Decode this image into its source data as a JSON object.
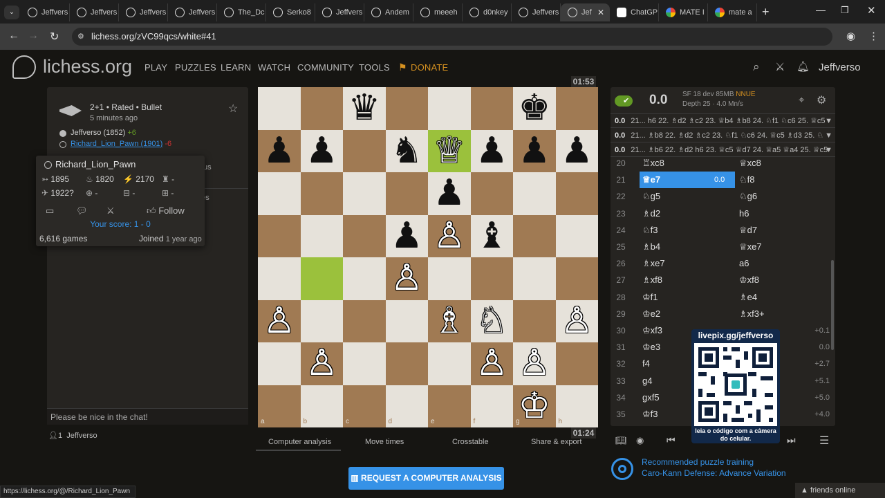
{
  "browser": {
    "tabs": [
      {
        "label": "Jeffvers",
        "icon": "lichess-icon"
      },
      {
        "label": "Jeffvers",
        "icon": "lichess-icon"
      },
      {
        "label": "Jeffvers",
        "icon": "lichess-icon"
      },
      {
        "label": "Jeffvers",
        "icon": "lichess-icon"
      },
      {
        "label": "The_Dc",
        "icon": "lichess-icon"
      },
      {
        "label": "Serko8",
        "icon": "lichess-icon"
      },
      {
        "label": "Jeffvers",
        "icon": "lichess-icon"
      },
      {
        "label": "Andem",
        "icon": "lichess-icon"
      },
      {
        "label": "meeeh",
        "icon": "lichess-icon"
      },
      {
        "label": "d0nkey",
        "icon": "lichess-icon"
      },
      {
        "label": "Jeffvers",
        "icon": "lichess-icon"
      },
      {
        "label": "Jef",
        "icon": "lichess-icon",
        "active": true
      },
      {
        "label": "ChatGP",
        "icon": "chatgpt-icon"
      },
      {
        "label": "MATE I",
        "icon": "google-icon"
      },
      {
        "label": "mate a",
        "icon": "google-icon"
      }
    ],
    "url": "lichess.org/zVC99qcs/white#41",
    "status_url": "https://lichess.org/@/Richard_Lion_Pawn"
  },
  "site": {
    "logo": "lichess.org",
    "nav": [
      "PLAY",
      "PUZZLES",
      "LEARN",
      "WATCH",
      "COMMUNITY",
      "TOOLS"
    ],
    "donate": "DONATE",
    "username": "Jeffverso"
  },
  "game": {
    "mode": "2+1 • Rated • Bullet",
    "time_ago": "5 minutes ago",
    "white_player": "Jeffverso (1852)",
    "white_diff": "+6",
    "black_player": "Richard_Lion_Pawn (1901)",
    "black_diff": "-6",
    "chat_placeholder": "Please be nice in the chat!",
    "spectators": "1",
    "spectator_name": "Jeffverso",
    "hidden_tab_text": "us",
    "hidden_tab_text2": "otes"
  },
  "popup": {
    "name": "Richard_Lion_Pawn",
    "ratings": [
      "1895",
      "1820",
      "2170",
      "-",
      "1922?",
      "-",
      "-",
      "-"
    ],
    "follow": "Follow",
    "score_label": "Your score:",
    "score": "1 - 0",
    "games": "6,616 games",
    "joined_label": "Joined",
    "joined": "1 year ago"
  },
  "board": {
    "clock_top": "01:53",
    "clock_bottom": "01:24",
    "ranks": [
      "8",
      "7",
      "6",
      "5",
      "4",
      "3",
      "2",
      "1"
    ],
    "files": [
      "a",
      "b",
      "c",
      "d",
      "e",
      "f",
      "g",
      "h"
    ],
    "highlight_squares": [
      "e7",
      "b4"
    ],
    "pieces": [
      {
        "sq": "c8",
        "glyph": "♛",
        "color": "b"
      },
      {
        "sq": "g8",
        "glyph": "♚",
        "color": "b"
      },
      {
        "sq": "a7",
        "glyph": "♟",
        "color": "b"
      },
      {
        "sq": "b7",
        "glyph": "♟",
        "color": "b"
      },
      {
        "sq": "d7",
        "glyph": "♞",
        "color": "b"
      },
      {
        "sq": "e7",
        "glyph": "♕",
        "color": "w"
      },
      {
        "sq": "f7",
        "glyph": "♟",
        "color": "b"
      },
      {
        "sq": "g7",
        "glyph": "♟",
        "color": "b"
      },
      {
        "sq": "h7",
        "glyph": "♟",
        "color": "b"
      },
      {
        "sq": "e6",
        "glyph": "♟",
        "color": "b"
      },
      {
        "sq": "d5",
        "glyph": "♟",
        "color": "b"
      },
      {
        "sq": "e5",
        "glyph": "♙",
        "color": "w"
      },
      {
        "sq": "f5",
        "glyph": "♝",
        "color": "b"
      },
      {
        "sq": "d4",
        "glyph": "♙",
        "color": "w"
      },
      {
        "sq": "a3",
        "glyph": "♙",
        "color": "w"
      },
      {
        "sq": "e3",
        "glyph": "♗",
        "color": "w"
      },
      {
        "sq": "f3",
        "glyph": "♘",
        "color": "w"
      },
      {
        "sq": "h3",
        "glyph": "♙",
        "color": "w"
      },
      {
        "sq": "b2",
        "glyph": "♙",
        "color": "w"
      },
      {
        "sq": "f2",
        "glyph": "♙",
        "color": "w"
      },
      {
        "sq": "g2",
        "glyph": "♙",
        "color": "w"
      },
      {
        "sq": "g1",
        "glyph": "♔",
        "color": "w"
      }
    ]
  },
  "under_board_tabs": [
    "Computer analysis",
    "Move times",
    "Crosstable",
    "Share & export"
  ],
  "request_analysis": "REQUEST A COMPUTER ANALYSIS",
  "engine": {
    "eval": "0.0",
    "name": "SF 18 dev 85MB",
    "nnue": "NNUE",
    "depth": "Depth 25 · 4.0 Mn/s",
    "lines": [
      {
        "eval": "0.0",
        "moves": "21... h6 22. ♗d2 ♗c2 23. ♕b4 ♗b8 24. ♘f1 ♘c6 25. ♕c5"
      },
      {
        "eval": "0.0",
        "moves": "21... ♗b8 22. ♗d2 ♗c2 23. ♘f1 ♘c6 24. ♕c5 ♗d3 25. ♘"
      },
      {
        "eval": "0.0",
        "moves": "21... ♗b6 22. ♗d2 h6 23. ♕c5 ♕d7 24. ♕a5 ♕a4 25. ♕c5"
      }
    ]
  },
  "moves": [
    {
      "n": "20",
      "w": "♖xc8",
      "b": "♕xc8",
      "ev": ""
    },
    {
      "n": "21",
      "w": "♕e7",
      "b": "♘f8",
      "ev": "0.0",
      "current": true
    },
    {
      "n": "22",
      "w": "♘g5",
      "b": "♘g6",
      "ev": ""
    },
    {
      "n": "23",
      "w": "♗d2",
      "b": "h6",
      "ev": ""
    },
    {
      "n": "24",
      "w": "♘f3",
      "b": "♕d7",
      "ev": ""
    },
    {
      "n": "25",
      "w": "♗b4",
      "b": "♕xe7",
      "ev": ""
    },
    {
      "n": "26",
      "w": "♗xe7",
      "b": "a6",
      "ev": ""
    },
    {
      "n": "27",
      "w": "♗xf8",
      "b": "♔xf8",
      "ev": ""
    },
    {
      "n": "28",
      "w": "♔f1",
      "b": "♗e4",
      "ev": ""
    },
    {
      "n": "29",
      "w": "♔e2",
      "b": "♗xf3+",
      "ev": ""
    },
    {
      "n": "30",
      "w": "♔xf3",
      "b": "",
      "ev": "+0.1"
    },
    {
      "n": "31",
      "w": "♔e3",
      "b": "",
      "ev": "0.0"
    },
    {
      "n": "32",
      "w": "f4",
      "b": "",
      "ev": "+2.7"
    },
    {
      "n": "33",
      "w": "g4",
      "b": "",
      "ev": "+5.1"
    },
    {
      "n": "34",
      "w": "gxf5",
      "b": "",
      "ev": "+5.0"
    },
    {
      "n": "35",
      "w": "♔f3",
      "b": "",
      "ev": "+4.0"
    }
  ],
  "overlay": {
    "title": "livepix.gg/jeffverso",
    "caption": "leia o código com a câmera do celular."
  },
  "puzzle": {
    "title": "Recommended puzzle training",
    "subtitle": "Caro-Kann Defense: Advance Variation"
  },
  "friends": "friends online",
  "colors": {
    "accent": "#3692e7",
    "light_sq": "#e6e2da",
    "dark_sq": "#a07a53",
    "highlight": "#9bc13c",
    "positive": "#629924",
    "negative": "#cc3333"
  }
}
